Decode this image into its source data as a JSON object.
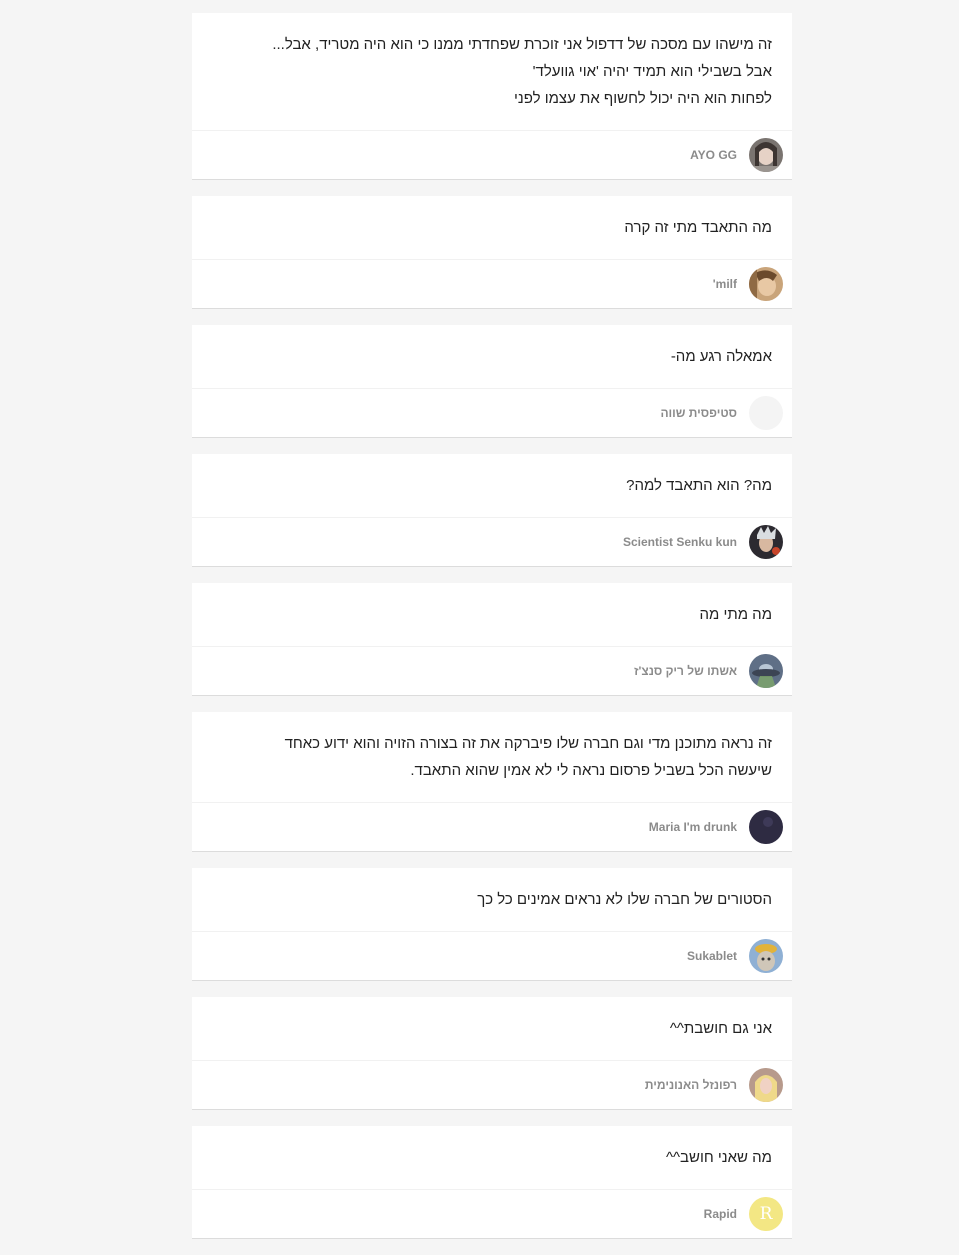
{
  "comments": [
    {
      "lines": [
        "זה מישהו עם מסכה של דדפול אני זוכרת שפחדתי ממנו כי הוא היה מטריד, אבל...",
        "אבל בשבילי הוא תמיד יהיה 'אוי גוועלד'",
        "לפחות הוא היה יכול לחשוף את עצמו לפני"
      ],
      "author": "AYO GG"
    },
    {
      "lines": [
        "מה התאבד מתי זה קרה"
      ],
      "author": "milf'"
    },
    {
      "lines": [
        "אמאלה רגע מה-"
      ],
      "author": "סטיפסית שווה"
    },
    {
      "lines": [
        "מה? הוא התאבד למה?"
      ],
      "author": "Scientist Senku kun"
    },
    {
      "lines": [
        "מה מתי מה"
      ],
      "author": "אשתו של ריק סנצ'ז"
    },
    {
      "lines": [
        "זה נראה מתוכנן מדי וגם חברה שלו פיברקה את זה בצורה הזויה והוא ידוע כאחד",
        "שיעשה הכל בשביל פרסום נראה לי לא אמין שהוא התאבד."
      ],
      "author": "Maria I'm drunk"
    },
    {
      "lines": [
        "הסטורים של חברה שלו לא נראים אמינים כל כך"
      ],
      "author": "Sukablet"
    },
    {
      "lines": [
        "אני גם חושבת^^"
      ],
      "author": "רפונזל האנונימית"
    },
    {
      "lines": [
        "מה שאני חושב^^"
      ],
      "author": "Rapid",
      "avatar_letter": "R"
    }
  ]
}
